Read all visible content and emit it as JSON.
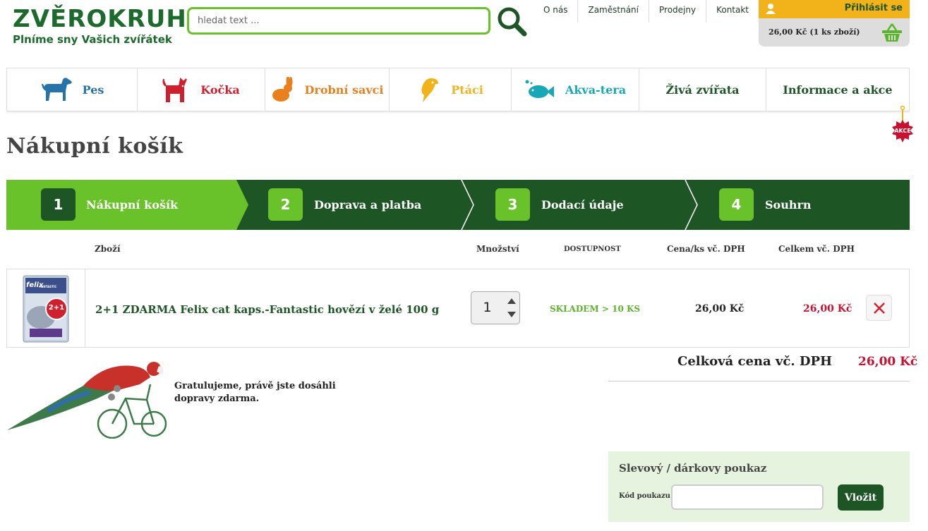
{
  "brand": {
    "name": "ZVĚROKRUH",
    "tagline": "Plníme sny Vašich zvířátek"
  },
  "search": {
    "placeholder": "hledat text ..."
  },
  "topnav": [
    "O nás",
    "Zaměstnání",
    "Prodejny",
    "Kontakt"
  ],
  "account": {
    "login_label": "Přihlásit se",
    "cart_summary": "26,00 Kč (1 ks zboží)"
  },
  "categories": [
    {
      "label": "Pes",
      "color": "#2474a9",
      "icon": "dog-icon"
    },
    {
      "label": "Kočka",
      "color": "#d0202e",
      "icon": "cat-icon"
    },
    {
      "label": "Drobní savci",
      "color": "#e8801e",
      "icon": "rabbit-icon"
    },
    {
      "label": "Ptáci",
      "color": "#f2b21a",
      "icon": "parrot-icon"
    },
    {
      "label": "Akva-tera",
      "color": "#17a8b8",
      "icon": "fish-icon"
    },
    {
      "label": "Živá zvířata",
      "color": "#1d5524",
      "icon": ""
    },
    {
      "label": "Informace a akce",
      "color": "#1d5524",
      "icon": ""
    }
  ],
  "akce_badge": "AKCE",
  "page_title": "Nákupní košík",
  "steps": [
    {
      "num": "1",
      "label": "Nákupní košík",
      "active": true
    },
    {
      "num": "2",
      "label": "Doprava a platba",
      "active": false
    },
    {
      "num": "3",
      "label": "Dodací údaje",
      "active": false
    },
    {
      "num": "4",
      "label": "Souhrn",
      "active": false
    }
  ],
  "table": {
    "headers": {
      "product": "Zboží",
      "qty": "Množství",
      "availability": "DOSTUPNOST",
      "unit_price": "Cena/ks vč. DPH",
      "total": "Celkem vč. DPH"
    },
    "rows": [
      {
        "name": "2+1 ZDARMA Felix cat kaps.-Fantastic hovězí v želé 100 g",
        "qty": "1",
        "availability": "SKLADEM > 10 KS",
        "unit_price": "26,00 Kč",
        "total": "26,00 Kč",
        "promo": "2+1",
        "brand": "felix",
        "variant": "FANTASTIC"
      }
    ]
  },
  "summary": {
    "label": "Celková cena vč. DPH",
    "value": "26,00 Kč"
  },
  "shipping_note": "Gratulujeme, právě jste dosáhli dopravy zdarma.",
  "voucher": {
    "title": "Slevový / dárkovy poukaz",
    "code_label": "Kód poukazu",
    "submit_label": "Vložit"
  },
  "colors": {
    "brand_green": "#1d5524",
    "accent_green": "#6ac22a",
    "price_red": "#c8112e",
    "gold": "#f2b21a"
  }
}
